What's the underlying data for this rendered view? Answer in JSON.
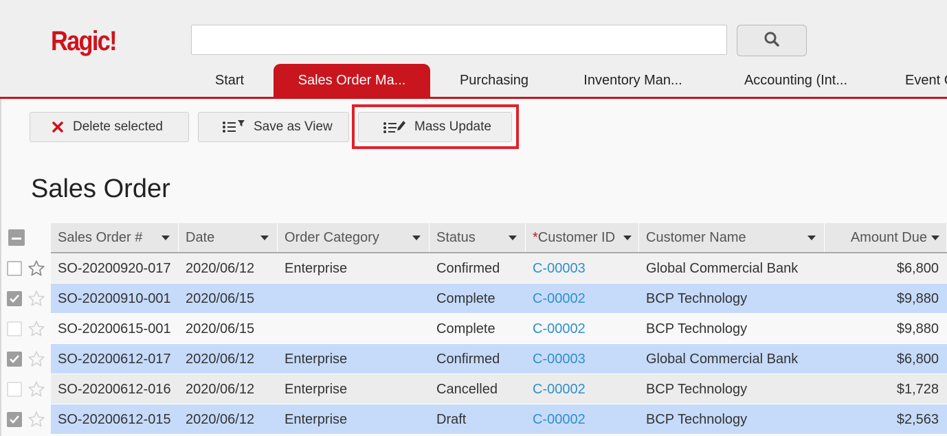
{
  "app": {
    "logo_text": "Ragic!",
    "brand_color": "#c9151e"
  },
  "search": {
    "value": "",
    "placeholder": "",
    "button_icon": "search-icon"
  },
  "tabs": [
    {
      "label": "Start",
      "active": false
    },
    {
      "label": "Sales Order Ma...",
      "active": true
    },
    {
      "label": "Purchasing",
      "active": false
    },
    {
      "label": "Inventory Man...",
      "active": false
    },
    {
      "label": "Accounting (Int...",
      "active": false
    },
    {
      "label": "Event C",
      "active": false
    }
  ],
  "toolbar": {
    "delete_label": "Delete selected",
    "save_view_label": "Save as View",
    "mass_update_label": "Mass Update"
  },
  "page": {
    "title": "Sales Order"
  },
  "table": {
    "columns": [
      {
        "label": "Sales Order #",
        "required": false
      },
      {
        "label": "Date",
        "required": false
      },
      {
        "label": "Order Category",
        "required": false
      },
      {
        "label": "Status",
        "required": false
      },
      {
        "label": "Customer ID",
        "required": true
      },
      {
        "label": "Customer Name",
        "required": false
      },
      {
        "label": "Amount Due",
        "required": false
      }
    ],
    "rows": [
      {
        "checked": false,
        "order": "SO-20200920-017",
        "date": "2020/06/12",
        "category": "Enterprise",
        "status": "Confirmed",
        "customer_id": "C-00003",
        "customer_name": "Global Commercial Bank",
        "amount": "$6,800"
      },
      {
        "checked": true,
        "order": "SO-20200910-001",
        "date": "2020/06/15",
        "category": "",
        "status": "Complete",
        "customer_id": "C-00002",
        "customer_name": "BCP Technology",
        "amount": "$9,880"
      },
      {
        "checked": false,
        "order": "SO-20200615-001",
        "date": "2020/06/15",
        "category": "",
        "status": "Complete",
        "customer_id": "C-00002",
        "customer_name": "BCP Technology",
        "amount": "$9,880"
      },
      {
        "checked": true,
        "order": "SO-20200612-017",
        "date": "2020/06/12",
        "category": "Enterprise",
        "status": "Confirmed",
        "customer_id": "C-00003",
        "customer_name": "Global Commercial Bank",
        "amount": "$6,800"
      },
      {
        "checked": false,
        "order": "SO-20200612-016",
        "date": "2020/06/12",
        "category": "Enterprise",
        "status": "Cancelled",
        "customer_id": "C-00002",
        "customer_name": "BCP Technology",
        "amount": "$1,728"
      },
      {
        "checked": true,
        "order": "SO-20200612-015",
        "date": "2020/06/12",
        "category": "Enterprise",
        "status": "Draft",
        "customer_id": "C-00002",
        "customer_name": "BCP Technology",
        "amount": "$2,563"
      }
    ]
  }
}
